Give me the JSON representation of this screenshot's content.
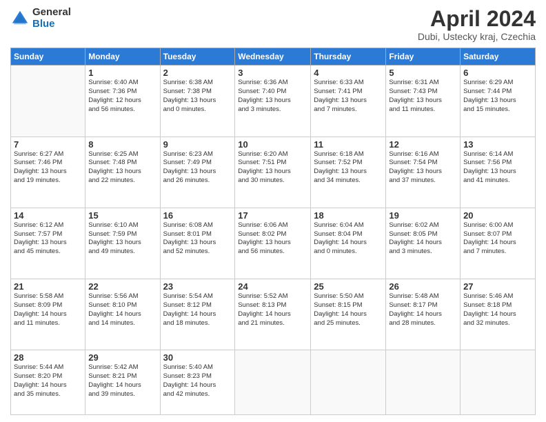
{
  "header": {
    "logo_general": "General",
    "logo_blue": "Blue",
    "title": "April 2024",
    "subtitle": "Dubi, Ustecky kraj, Czechia"
  },
  "weekdays": [
    "Sunday",
    "Monday",
    "Tuesday",
    "Wednesday",
    "Thursday",
    "Friday",
    "Saturday"
  ],
  "weeks": [
    [
      {
        "day": "",
        "info": ""
      },
      {
        "day": "1",
        "info": "Sunrise: 6:40 AM\nSunset: 7:36 PM\nDaylight: 12 hours\nand 56 minutes."
      },
      {
        "day": "2",
        "info": "Sunrise: 6:38 AM\nSunset: 7:38 PM\nDaylight: 13 hours\nand 0 minutes."
      },
      {
        "day": "3",
        "info": "Sunrise: 6:36 AM\nSunset: 7:40 PM\nDaylight: 13 hours\nand 3 minutes."
      },
      {
        "day": "4",
        "info": "Sunrise: 6:33 AM\nSunset: 7:41 PM\nDaylight: 13 hours\nand 7 minutes."
      },
      {
        "day": "5",
        "info": "Sunrise: 6:31 AM\nSunset: 7:43 PM\nDaylight: 13 hours\nand 11 minutes."
      },
      {
        "day": "6",
        "info": "Sunrise: 6:29 AM\nSunset: 7:44 PM\nDaylight: 13 hours\nand 15 minutes."
      }
    ],
    [
      {
        "day": "7",
        "info": "Sunrise: 6:27 AM\nSunset: 7:46 PM\nDaylight: 13 hours\nand 19 minutes."
      },
      {
        "day": "8",
        "info": "Sunrise: 6:25 AM\nSunset: 7:48 PM\nDaylight: 13 hours\nand 22 minutes."
      },
      {
        "day": "9",
        "info": "Sunrise: 6:23 AM\nSunset: 7:49 PM\nDaylight: 13 hours\nand 26 minutes."
      },
      {
        "day": "10",
        "info": "Sunrise: 6:20 AM\nSunset: 7:51 PM\nDaylight: 13 hours\nand 30 minutes."
      },
      {
        "day": "11",
        "info": "Sunrise: 6:18 AM\nSunset: 7:52 PM\nDaylight: 13 hours\nand 34 minutes."
      },
      {
        "day": "12",
        "info": "Sunrise: 6:16 AM\nSunset: 7:54 PM\nDaylight: 13 hours\nand 37 minutes."
      },
      {
        "day": "13",
        "info": "Sunrise: 6:14 AM\nSunset: 7:56 PM\nDaylight: 13 hours\nand 41 minutes."
      }
    ],
    [
      {
        "day": "14",
        "info": "Sunrise: 6:12 AM\nSunset: 7:57 PM\nDaylight: 13 hours\nand 45 minutes."
      },
      {
        "day": "15",
        "info": "Sunrise: 6:10 AM\nSunset: 7:59 PM\nDaylight: 13 hours\nand 49 minutes."
      },
      {
        "day": "16",
        "info": "Sunrise: 6:08 AM\nSunset: 8:01 PM\nDaylight: 13 hours\nand 52 minutes."
      },
      {
        "day": "17",
        "info": "Sunrise: 6:06 AM\nSunset: 8:02 PM\nDaylight: 13 hours\nand 56 minutes."
      },
      {
        "day": "18",
        "info": "Sunrise: 6:04 AM\nSunset: 8:04 PM\nDaylight: 14 hours\nand 0 minutes."
      },
      {
        "day": "19",
        "info": "Sunrise: 6:02 AM\nSunset: 8:05 PM\nDaylight: 14 hours\nand 3 minutes."
      },
      {
        "day": "20",
        "info": "Sunrise: 6:00 AM\nSunset: 8:07 PM\nDaylight: 14 hours\nand 7 minutes."
      }
    ],
    [
      {
        "day": "21",
        "info": "Sunrise: 5:58 AM\nSunset: 8:09 PM\nDaylight: 14 hours\nand 11 minutes."
      },
      {
        "day": "22",
        "info": "Sunrise: 5:56 AM\nSunset: 8:10 PM\nDaylight: 14 hours\nand 14 minutes."
      },
      {
        "day": "23",
        "info": "Sunrise: 5:54 AM\nSunset: 8:12 PM\nDaylight: 14 hours\nand 18 minutes."
      },
      {
        "day": "24",
        "info": "Sunrise: 5:52 AM\nSunset: 8:13 PM\nDaylight: 14 hours\nand 21 minutes."
      },
      {
        "day": "25",
        "info": "Sunrise: 5:50 AM\nSunset: 8:15 PM\nDaylight: 14 hours\nand 25 minutes."
      },
      {
        "day": "26",
        "info": "Sunrise: 5:48 AM\nSunset: 8:17 PM\nDaylight: 14 hours\nand 28 minutes."
      },
      {
        "day": "27",
        "info": "Sunrise: 5:46 AM\nSunset: 8:18 PM\nDaylight: 14 hours\nand 32 minutes."
      }
    ],
    [
      {
        "day": "28",
        "info": "Sunrise: 5:44 AM\nSunset: 8:20 PM\nDaylight: 14 hours\nand 35 minutes."
      },
      {
        "day": "29",
        "info": "Sunrise: 5:42 AM\nSunset: 8:21 PM\nDaylight: 14 hours\nand 39 minutes."
      },
      {
        "day": "30",
        "info": "Sunrise: 5:40 AM\nSunset: 8:23 PM\nDaylight: 14 hours\nand 42 minutes."
      },
      {
        "day": "",
        "info": ""
      },
      {
        "day": "",
        "info": ""
      },
      {
        "day": "",
        "info": ""
      },
      {
        "day": "",
        "info": ""
      }
    ]
  ]
}
